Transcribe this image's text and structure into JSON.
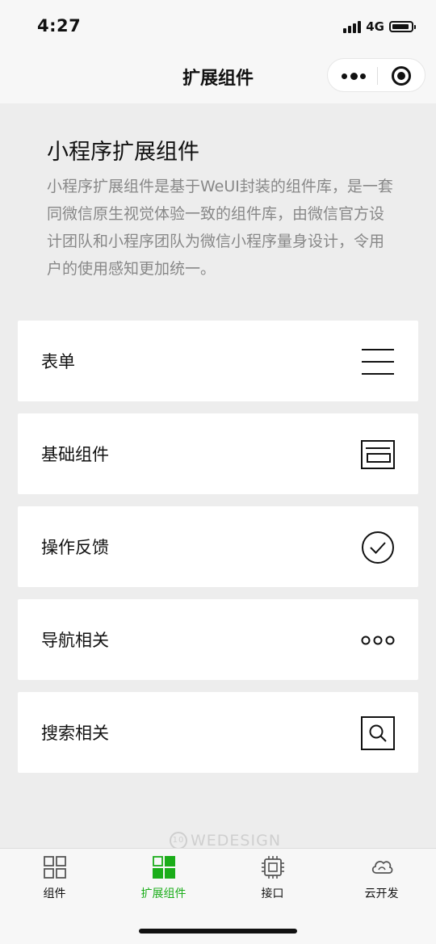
{
  "status": {
    "time": "4:27",
    "network": "4G"
  },
  "nav": {
    "title": "扩展组件",
    "more_icon": "more-dots-icon",
    "close_icon": "miniprogram-close-icon"
  },
  "hero": {
    "title": "小程序扩展组件",
    "description": "小程序扩展组件是基于WeUI封装的组件库，是一套同微信原生视觉体验一致的组件库，由微信官方设计团队和小程序团队为微信小程序量身设计，令用户的使用感知更加统一。"
  },
  "cards": [
    {
      "label": "表单",
      "icon": "menu-lines-icon"
    },
    {
      "label": "基础组件",
      "icon": "component-box-icon"
    },
    {
      "label": "操作反馈",
      "icon": "check-circle-icon"
    },
    {
      "label": "导航相关",
      "icon": "dots-icon"
    },
    {
      "label": "搜索相关",
      "icon": "search-icon"
    }
  ],
  "watermark": {
    "logo": "10",
    "text": "WEDESIGN"
  },
  "tabs": [
    {
      "label": "组件",
      "icon": "grid-outline-icon",
      "active": false
    },
    {
      "label": "扩展组件",
      "icon": "grid-filled-icon",
      "active": true
    },
    {
      "label": "接口",
      "icon": "chip-icon",
      "active": false
    },
    {
      "label": "云开发",
      "icon": "cloud-icon",
      "active": false
    }
  ],
  "colors": {
    "accent": "#1aad19",
    "background": "#ededed",
    "secondary_text": "#888888"
  }
}
